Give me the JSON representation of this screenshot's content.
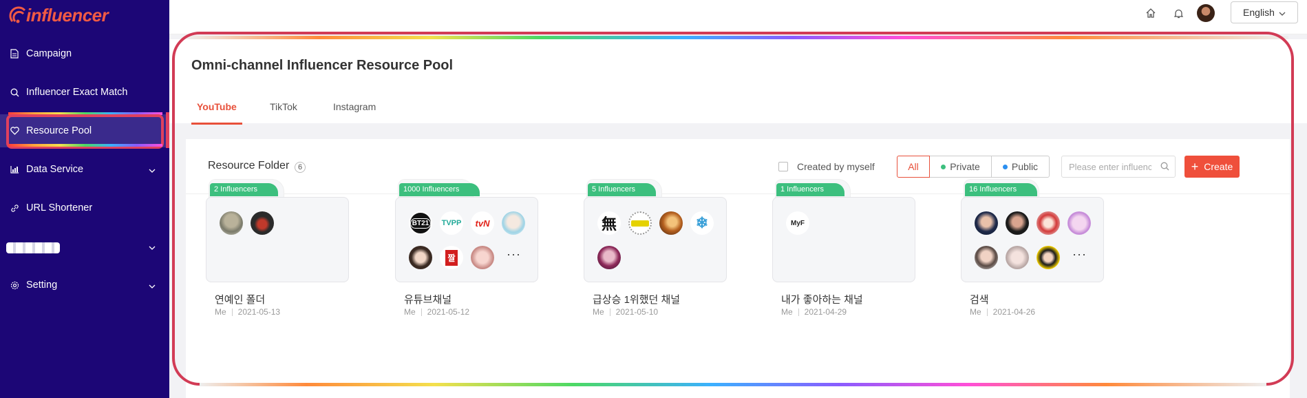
{
  "app": {
    "brand": "influencer"
  },
  "sidebar": {
    "items": [
      {
        "label": "Campaign",
        "icon": "document-icon"
      },
      {
        "label": "Influencer Exact Match",
        "icon": "search-icon"
      },
      {
        "label": "Resource Pool",
        "icon": "heart-icon",
        "active": true
      },
      {
        "label": "Data Service",
        "icon": "bar-chart-icon",
        "expandable": true
      },
      {
        "label": "URL Shortener",
        "icon": "link-icon"
      },
      {
        "label": "",
        "icon": "",
        "expandable": true,
        "blurred": true
      },
      {
        "label": "Setting",
        "icon": "gear-icon",
        "expandable": true
      }
    ]
  },
  "topbar": {
    "language": "English"
  },
  "page": {
    "title": "Omni-channel Influencer Resource Pool",
    "tabs": [
      "YouTube",
      "TikTok",
      "Instagram"
    ],
    "active_tab": "YouTube"
  },
  "folder_panel": {
    "title": "Resource Folder",
    "count": "6",
    "created_by_myself": "Created by myself",
    "filters": {
      "all": "All",
      "private": "Private",
      "public": "Public"
    },
    "search_placeholder": "Please enter influence...",
    "create_label": "Create"
  },
  "colors": {
    "accent": "#ef4f3b",
    "sidebar": "#1c0676",
    "badge": "#3cbf7e",
    "private_dot": "#3cbf7e",
    "public_dot": "#2b8ff0"
  },
  "folders": [
    {
      "badge": "2 Influencers",
      "name": "연예인 폴더",
      "owner": "Me",
      "date": "2021-05-13"
    },
    {
      "badge": "1000 Influencers",
      "name": "유튜브채널",
      "owner": "Me",
      "date": "2021-05-12",
      "avatar_texts": [
        "BT21",
        "TVPP",
        "tvN",
        "",
        "",
        "짤",
        ""
      ],
      "more": "···"
    },
    {
      "badge": "5 Influencers",
      "name": "급상승 1위했던 채널",
      "owner": "Me",
      "date": "2021-05-10",
      "avatar_texts": [
        "無",
        "",
        "",
        "❄",
        ""
      ]
    },
    {
      "badge": "1 Influencers",
      "name": "내가 좋아하는 채널",
      "owner": "Me",
      "date": "2021-04-29",
      "avatar_texts": [
        "MyF"
      ]
    },
    {
      "badge": "16 Influencers",
      "name": "검색",
      "owner": "Me",
      "date": "2021-04-26",
      "more": "···"
    }
  ]
}
